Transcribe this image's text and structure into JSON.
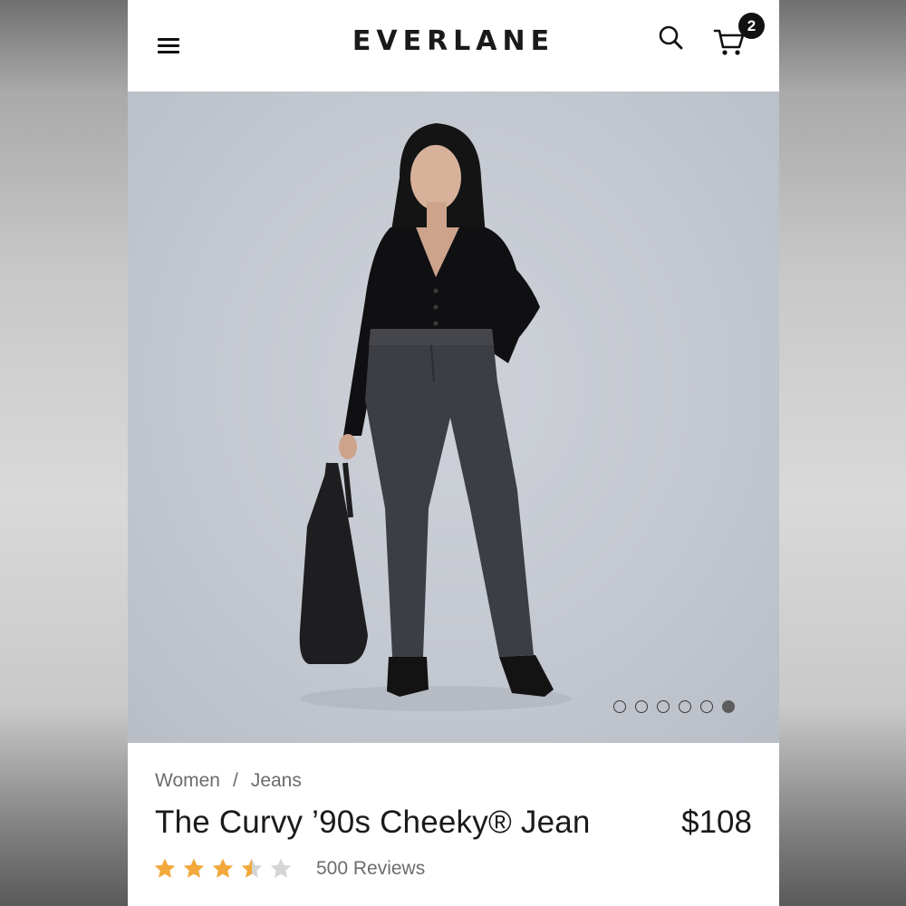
{
  "header": {
    "logo": "EVERLANE",
    "cart_count": "2"
  },
  "gallery": {
    "total_images": 6,
    "active_index": 5
  },
  "product": {
    "breadcrumb": [
      "Women",
      "Jeans"
    ],
    "breadcrumb_separator": "/",
    "title": "The Curvy ’90s Cheeky® Jean",
    "price": "$108",
    "rating": 3.5,
    "rating_max": 5,
    "reviews_label": "500 Reviews"
  },
  "colors": {
    "star_filled": "#f2a93b",
    "star_empty": "#d5d5d5",
    "text_primary": "#1a1a1a",
    "text_secondary": "#6c6c6c"
  },
  "icons": {
    "menu": "hamburger-menu-icon",
    "search": "search-icon",
    "cart": "shopping-cart-icon",
    "star": "star-icon"
  }
}
